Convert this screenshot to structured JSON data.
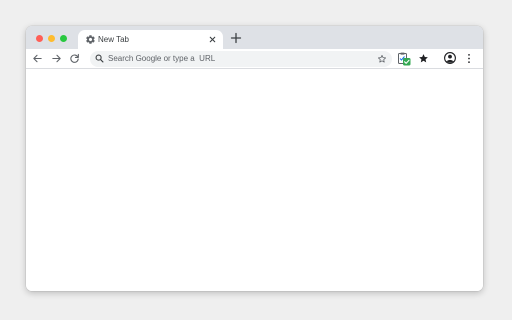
{
  "tab": {
    "title": "New Tab",
    "icon": "gear-icon"
  },
  "omnibox": {
    "placeholder": "Search Google or type a  URL"
  },
  "colors": {
    "close": "#ff5f57",
    "minimize": "#febc2e",
    "maximize": "#28c840",
    "extension_accent": "#34a853"
  }
}
